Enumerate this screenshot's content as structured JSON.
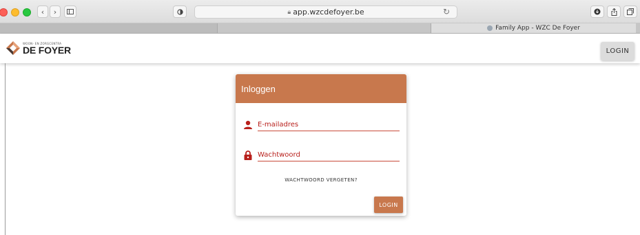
{
  "browser": {
    "url": "app.wzcdefoyer.be",
    "active_tab_title": "Family App - WZC De Foyer",
    "icons": [
      "back-icon",
      "forward-icon",
      "sidebar-icon",
      "privacy-shield-icon",
      "lock-icon",
      "reload-icon",
      "download-icon",
      "share-icon",
      "tabs-icon"
    ]
  },
  "header": {
    "logo_small": "WOON- EN ZORGCENTRA",
    "logo_big": "DE FOYER",
    "login_label": "LOGIN"
  },
  "login_card": {
    "title": "Inloggen",
    "email_placeholder": "E-mailadres",
    "password_placeholder": "Wachtwoord",
    "forgot_label": "WACHTWOORD VERGETEN?",
    "login_label": "LOGIN"
  },
  "colors": {
    "accent": "#c8784d",
    "field": "#b8201c"
  }
}
